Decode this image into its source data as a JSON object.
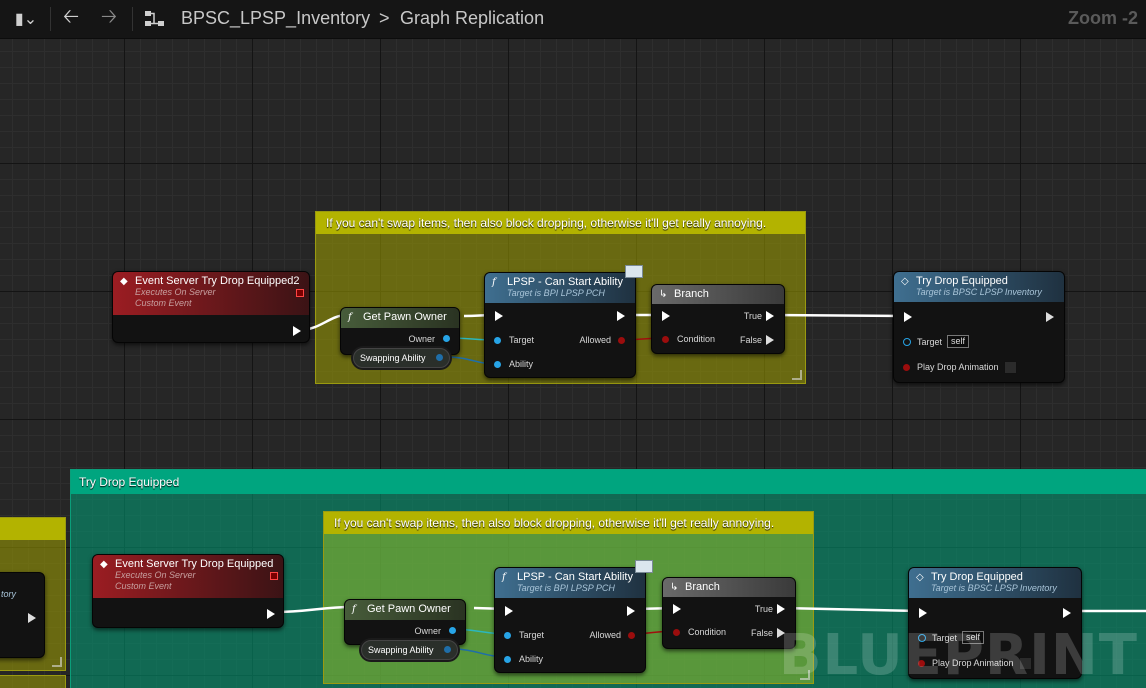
{
  "toolbar": {
    "breadcrumb_blueprint": "BPSC_LPSP_Inventory",
    "breadcrumb_separator": ">",
    "breadcrumb_graph": "Graph Replication",
    "zoom": "Zoom -2"
  },
  "comments": {
    "top_note": "If you can't swap items, then also block dropping, otherwise it'll get really annoying.",
    "group_title": "Try Drop Equipped",
    "bottom_note": "If you can't swap items, then also block dropping, otherwise it'll get really annoying."
  },
  "top": {
    "event_title": "Event Server Try Drop Equipped2",
    "event_sub1": "Executes On Server",
    "event_sub2": "Custom Event",
    "pawn_title": "Get Pawn Owner",
    "pawn_owner": "Owner",
    "swap_var": "Swapping Ability",
    "can_title": "LPSP - Can Start Ability",
    "can_sub": "Target is BPI LPSP PCH",
    "can_target": "Target",
    "can_ability": "Ability",
    "can_allowed": "Allowed",
    "branch_title": "Branch",
    "branch_true": "True",
    "branch_false": "False",
    "branch_cond": "Condition",
    "drop_title": "Try Drop Equipped",
    "drop_sub": "Target is BPSC LPSP Inventory",
    "drop_target": "Target",
    "drop_self": "self",
    "drop_play": "Play Drop Animation"
  },
  "bottom": {
    "left_partial": "tory",
    "event_title": "Event Server Try Drop Equipped",
    "event_sub1": "Executes On Server",
    "event_sub2": "Custom Event",
    "pawn_title": "Get Pawn Owner",
    "pawn_owner": "Owner",
    "swap_var": "Swapping Ability",
    "can_title": "LPSP - Can Start Ability",
    "can_sub": "Target is BPI LPSP PCH",
    "can_target": "Target",
    "can_ability": "Ability",
    "can_allowed": "Allowed",
    "branch_title": "Branch",
    "branch_true": "True",
    "branch_false": "False",
    "branch_cond": "Condition",
    "drop_title": "Try Drop Equipped",
    "drop_sub": "Target is BPSC LPSP Inventory",
    "drop_target": "Target",
    "drop_self": "self",
    "drop_play": "Play Drop Animation"
  },
  "watermark": "BLUEPRINT",
  "icons": {
    "bookmark": "bookmark-icon",
    "back": "arrow-left-icon",
    "forward": "arrow-right-icon",
    "graph": "graph-icon"
  }
}
